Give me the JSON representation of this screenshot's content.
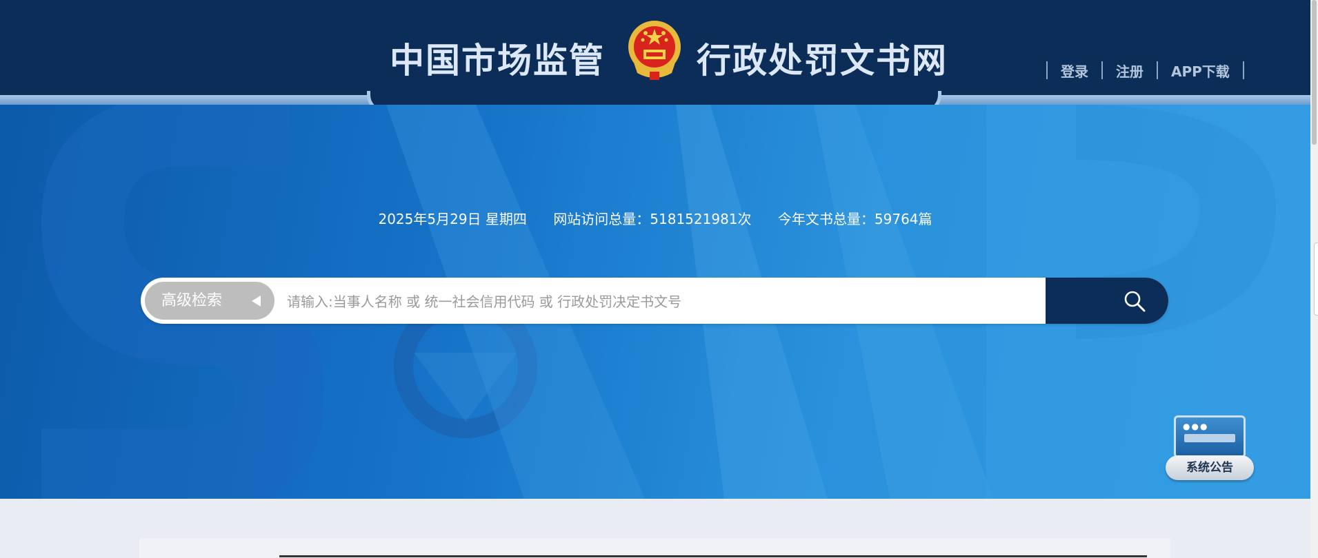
{
  "header": {
    "title_left": "中国市场监管",
    "title_right": "行政处罚文书网",
    "emblem_icon": "national-emblem-icon",
    "links": [
      "登录",
      "注册",
      "APP下载"
    ]
  },
  "info": {
    "date": "2025年5月29日 星期四",
    "visits": "网站访问总量：5181521981次",
    "documents": "今年文书总量：59764篇"
  },
  "search": {
    "advanced_label": "高级检索",
    "placeholder": "请输入:当事人名称 或 统一社会信用代码 或 行政处罚决定书文号",
    "button_icon": "search-icon"
  },
  "notice": {
    "label": "系统公告"
  },
  "colors": {
    "header_bg": "#0b2d57",
    "hero_blue": "#1673c8",
    "search_button": "#0b2d57"
  }
}
